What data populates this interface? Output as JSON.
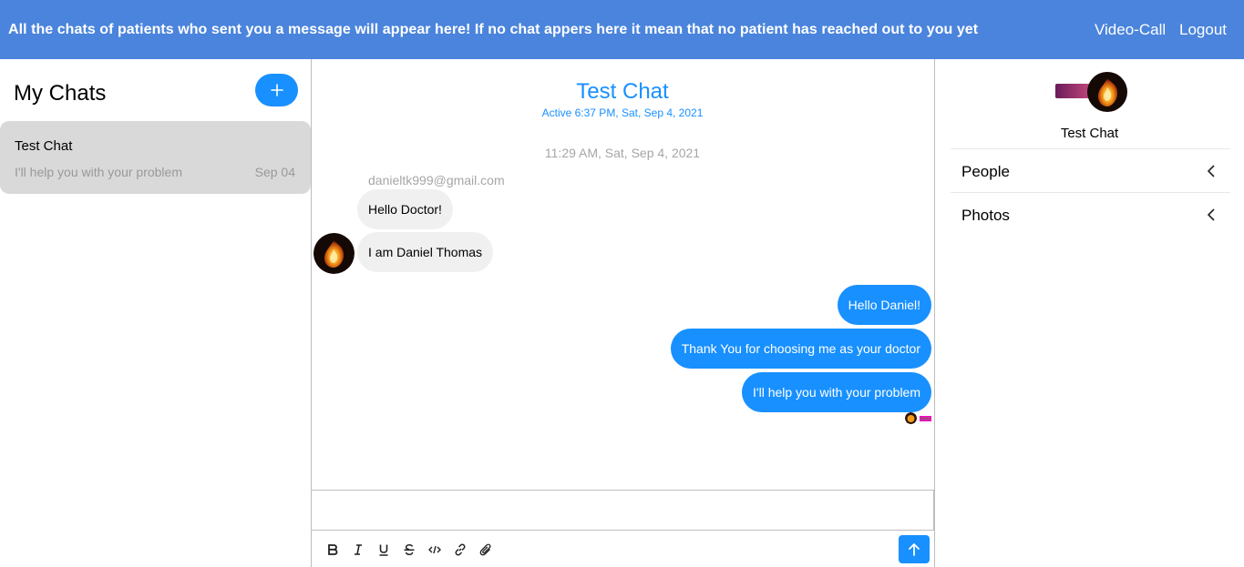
{
  "topbar": {
    "message": "All the chats of patients who sent you a message will appear here! If no chat appers here it mean that no patient has reached out to you yet",
    "video_call": "Video-Call",
    "logout": "Logout"
  },
  "sidebar": {
    "title": "My Chats",
    "new_chat_icon": "plus-icon",
    "chats": [
      {
        "title": "Test Chat",
        "preview": "I'll help you with your problem",
        "date": "Sep 04"
      }
    ]
  },
  "chat": {
    "title": "Test Chat",
    "subtitle": "Active 6:37 PM, Sat, Sep 4, 2021",
    "timestamp": "11:29 AM, Sat, Sep 4, 2021",
    "sender_email": "danieltk999@gmail.com",
    "incoming": [
      "Hello Doctor!",
      "I am Daniel Thomas"
    ],
    "outgoing": [
      "Hello Daniel!",
      "Thank You for choosing me as your doctor",
      "I'll help you with your problem"
    ]
  },
  "composer": {
    "toolbar_icons": [
      "bold-icon",
      "italic-icon",
      "underline-icon",
      "strikethrough-icon",
      "code-icon",
      "link-icon",
      "attachment-icon"
    ],
    "send_icon": "arrow-up-icon"
  },
  "details": {
    "title": "Test Chat",
    "rows": [
      {
        "label": "People",
        "icon": "chevron-left-icon"
      },
      {
        "label": "Photos",
        "icon": "chevron-left-icon"
      }
    ]
  },
  "colors": {
    "topbar": "#4a84dc",
    "accent": "#1890ff",
    "chat_card": "#d9d9d9",
    "bubble_in": "#f0f0f0"
  }
}
